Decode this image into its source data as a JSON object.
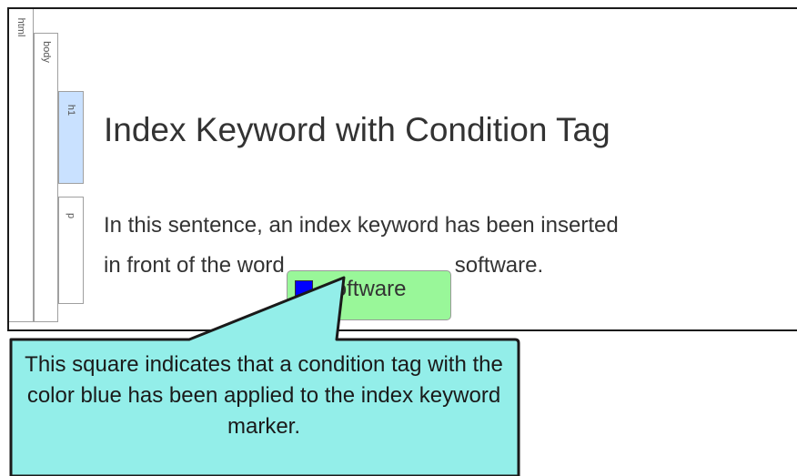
{
  "structure_bar": {
    "html_label": "html",
    "body_label": "body",
    "h1_label": "h1",
    "p_label": "p"
  },
  "content": {
    "heading": "Index Keyword with Condition Tag",
    "para_line1": "In this sentence, an index keyword has been inserted",
    "para_line2_before": "in front of the word",
    "keyword_marker": "software",
    "para_line2_after": "software."
  },
  "callout": {
    "text": "This square indicates that a condition tag with the color blue has been applied to the index keyword marker."
  },
  "colors": {
    "condition_tag": "#0000ff",
    "keyword_marker_bg": "#99f799",
    "callout_bg": "#93eee9",
    "h1_bar_bg": "#c9e1ff"
  }
}
